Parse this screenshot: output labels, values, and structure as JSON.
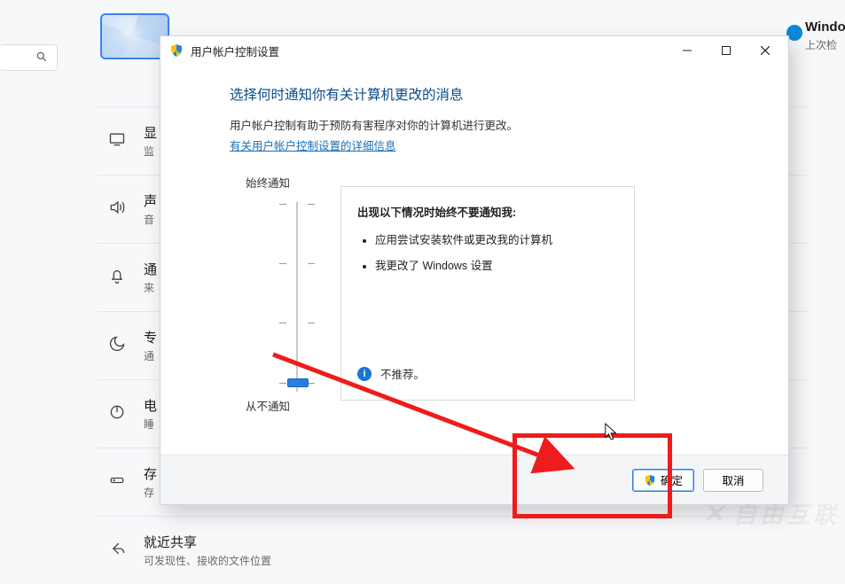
{
  "search": {
    "placeholder": ""
  },
  "right_panel": {
    "title": "Windo",
    "subtitle": "上次检"
  },
  "settings_rows": [
    {
      "icon": "monitor",
      "title": "显",
      "subtitle": "监"
    },
    {
      "icon": "sound",
      "title": "声",
      "subtitle": "音"
    },
    {
      "icon": "bell",
      "title": "通",
      "subtitle": "来"
    },
    {
      "icon": "moon",
      "title": "专",
      "subtitle": "通"
    },
    {
      "icon": "power",
      "title": "电",
      "subtitle": "睡"
    },
    {
      "icon": "storage",
      "title": "存",
      "subtitle": "存"
    },
    {
      "icon": "share",
      "title": "就近共享",
      "subtitle": "可发现性、接收的文件位置"
    }
  ],
  "dialog": {
    "title": "用户帐户控制设置",
    "heading": "选择何时通知你有关计算机更改的消息",
    "description": "用户帐户控制有助于预防有害程序对你的计算机进行更改。",
    "link": "有关用户帐户控制设置的详细信息",
    "slider": {
      "top_label": "始终通知",
      "bottom_label": "从不通知",
      "level_index": 3,
      "levels": 4
    },
    "info": {
      "title": "出现以下情况时始终不要通知我:",
      "items": [
        "应用尝试安装软件或更改我的计算机",
        "我更改了 Windows 设置"
      ],
      "footer": "不推荐。"
    },
    "buttons": {
      "ok": "确定",
      "cancel": "取消"
    }
  },
  "watermark": "自由互联"
}
